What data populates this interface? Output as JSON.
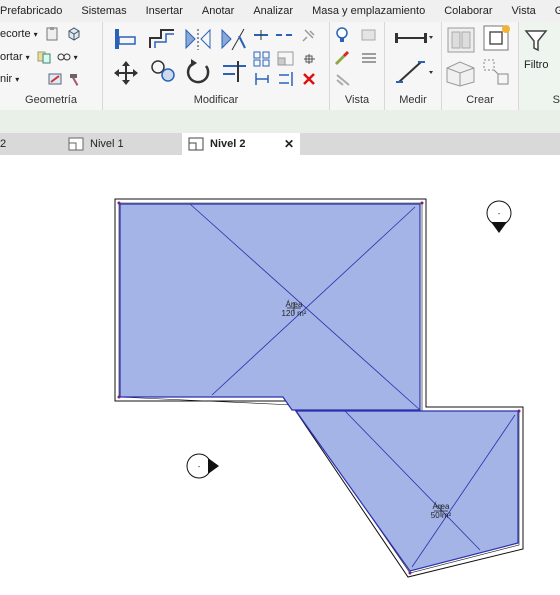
{
  "menu": {
    "items": [
      "Prefabricado",
      "Sistemas",
      "Insertar",
      "Anotar",
      "Analizar",
      "Masa y emplazamiento",
      "Colaborar",
      "Vista",
      "Ge"
    ]
  },
  "ribbon": {
    "geometria": {
      "label": "Geometría",
      "recortar": "ecorte",
      "cortar": "ortar",
      "unir": "nir"
    },
    "modificar": {
      "label": "Modificar"
    },
    "vista": {
      "label": "Vista"
    },
    "medir": {
      "label": "Medir"
    },
    "crear": {
      "label": "Crear"
    },
    "filtro": {
      "label": "Filtro"
    },
    "next_label": "S"
  },
  "tabs": {
    "partial": "2",
    "nivel1": "Nivel 1",
    "nivel2": "Nivel 2",
    "close": "✕"
  },
  "canvas": {
    "area1": {
      "name": "Área",
      "value": "120 m²"
    },
    "area2": {
      "name": "Área",
      "value": "50 m²"
    },
    "tag_dash": "-"
  },
  "colors": {
    "area_fill": "#a4b4e6",
    "area_stroke": "#2b2fae",
    "wall": "#111111"
  }
}
